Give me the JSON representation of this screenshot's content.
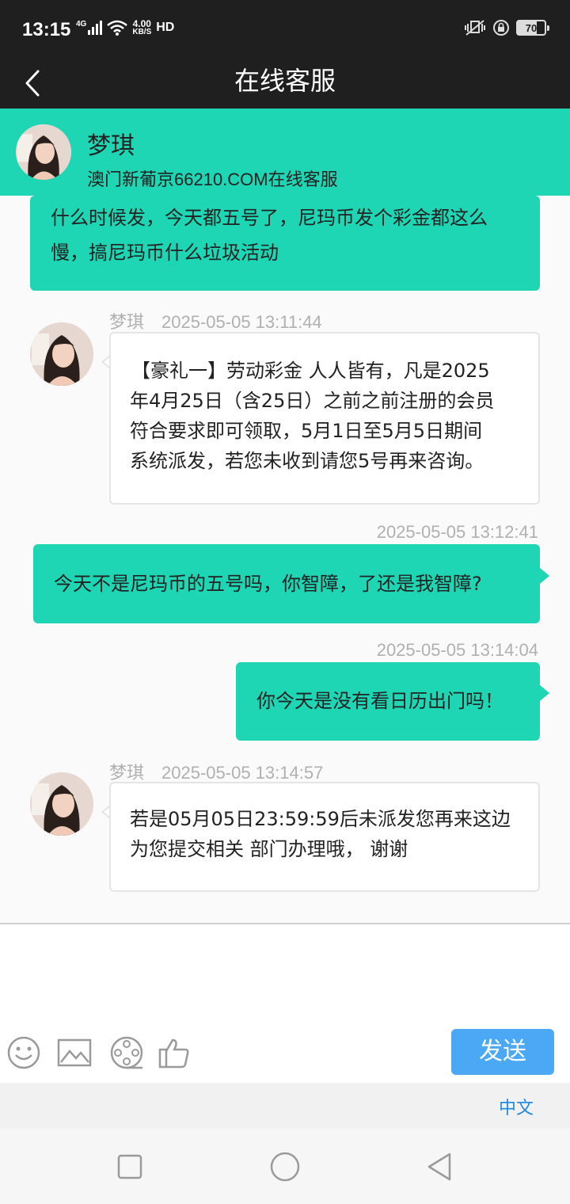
{
  "status_bar": {
    "time": "13:15",
    "network": "4G",
    "speed_value": "4.00",
    "speed_unit": "KB/S",
    "hd": "HD",
    "battery": "70",
    "battery_level": 0.7
  },
  "header": {
    "title": "在线客服"
  },
  "agent": {
    "name": "梦琪",
    "subtitle": "澳门新葡京66210.COM在线客服"
  },
  "messages": [
    {
      "side": "right",
      "lines": [
        "什么时候发，今天都五号了，尼玛币发个彩金都这么",
        "慢，搞尼玛币什么垃圾活动"
      ]
    },
    {
      "side": "left",
      "name": "梦琪",
      "time": "2025-05-05 13:11:44",
      "lines": [
        "【豪礼一】劳动彩金 人人皆有，凡是2025",
        "年4月25日（含25日）之前之前注册的会员",
        "符合要求即可领取，5月1日至5月5日期间",
        "系统派发，若您未收到请您5号再来咨询。"
      ]
    },
    {
      "side": "right",
      "time": "2025-05-05 13:12:41",
      "lines": [
        "今天不是尼玛币的五号吗，你智障，了还是我智障?"
      ]
    },
    {
      "side": "right",
      "time": "2025-05-05 13:14:04",
      "lines": [
        "你今天是没有看日历出门吗！"
      ]
    },
    {
      "side": "left",
      "name": "梦琪",
      "time": "2025-05-05 13:14:57",
      "lines": [
        "若是05月05日23:59:59后未派发您再来这边",
        "为您提交相关 部门办理哦， 谢谢"
      ]
    }
  ],
  "input": {
    "send_label": "发送",
    "language": "中文",
    "tools": [
      "smiley-icon",
      "image-icon",
      "video-icon",
      "thumbs-up-icon"
    ]
  },
  "colors": {
    "accent": "#1ed6b4",
    "send": "#4aa8f4",
    "topbar": "#1f1f1f"
  }
}
